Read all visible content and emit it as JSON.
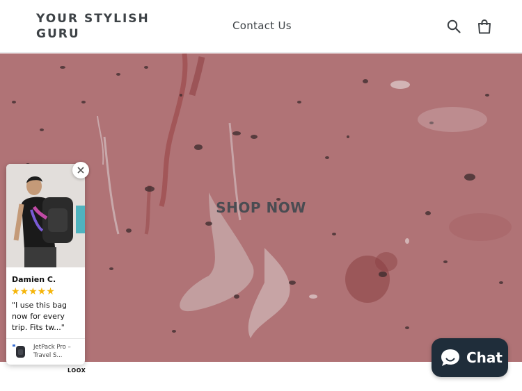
{
  "header": {
    "logo": "YOUR STYLISH GURU",
    "nav_link": "Contact Us",
    "search_icon": "search-icon",
    "cart_icon": "shopping-bag-icon"
  },
  "hero": {
    "cta": "SHOP NOW",
    "background_color": "#b07578"
  },
  "review_popup": {
    "reviewer": "Damien C.",
    "stars": "★★★★★",
    "rating": 5,
    "text": "\"I use this bag now for every trip. Fits tw...\"",
    "product": "JetPack Pro – Travel S...",
    "brand": "LOOX",
    "close_icon": "close-icon",
    "star_color": "#f5b50a"
  },
  "chat": {
    "label": "Chat",
    "icon": "chat-bubble-icon",
    "background_color": "#1f2d3a"
  }
}
